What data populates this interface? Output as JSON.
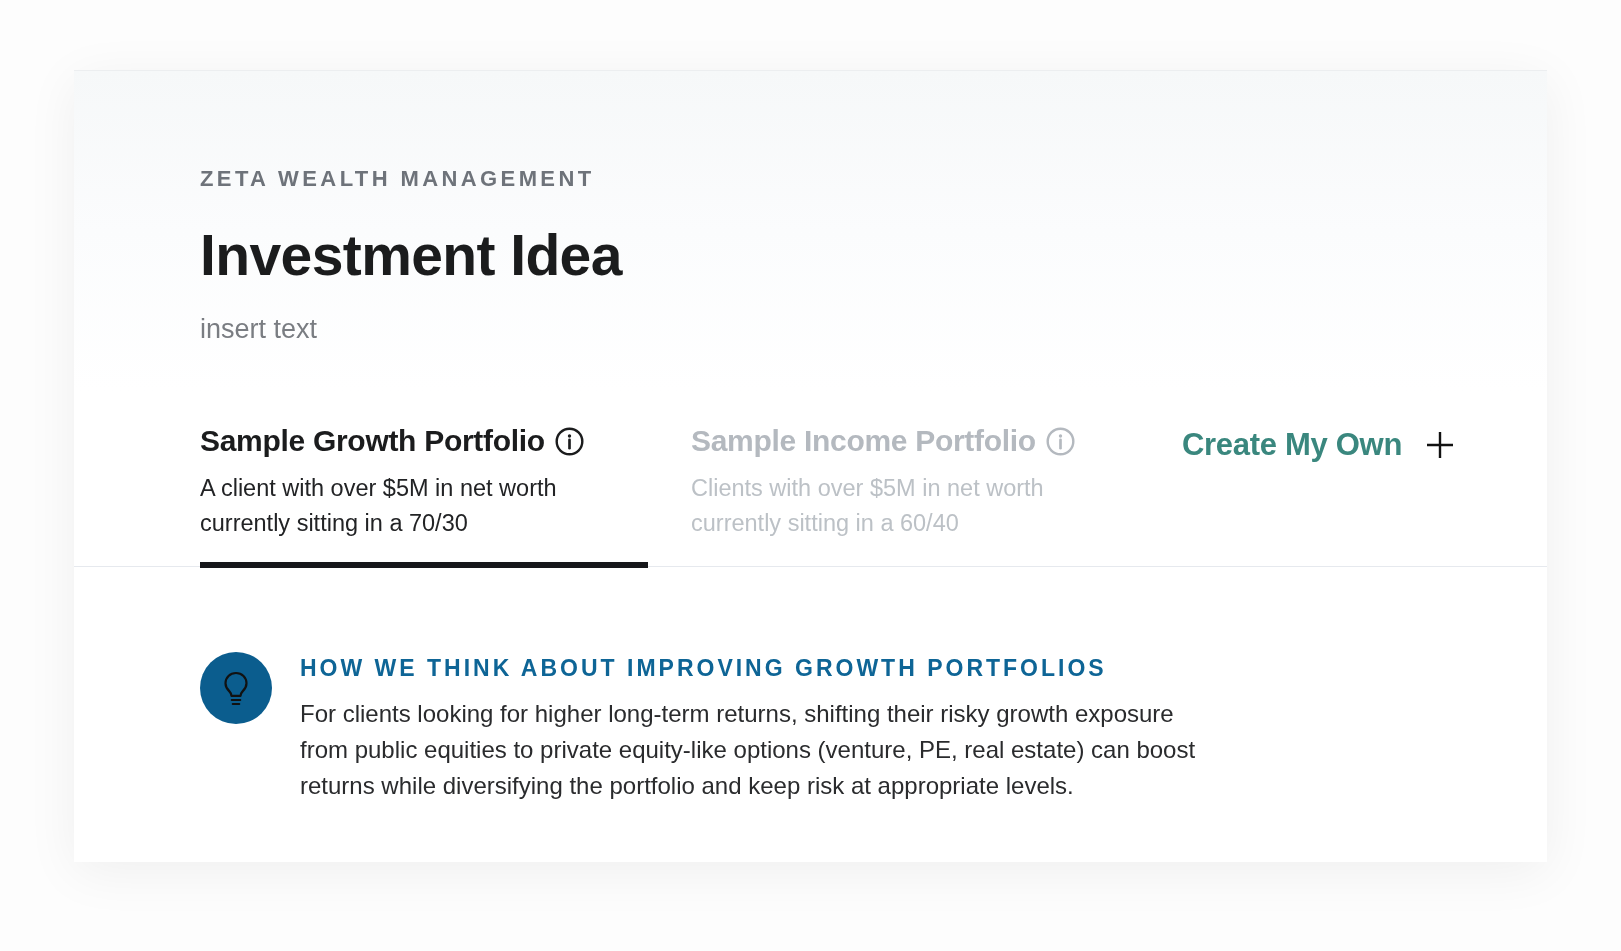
{
  "company": "ZETA WEALTH MANAGEMENT",
  "title": "Investment Idea",
  "subtitle": "insert text",
  "tabs": [
    {
      "label": "Sample Growth Portfolio",
      "description": "A client with over $5M in net worth currently sitting in a 70/30",
      "selected": true
    },
    {
      "label": "Sample Income Portfolio",
      "description": "Clients with over $5M in net worth currently sitting in a 60/40",
      "selected": false
    }
  ],
  "create_button": {
    "label": "Create My Own"
  },
  "insight": {
    "heading": "HOW WE THINK ABOUT IMPROVING GROWTH PORTFOLIOS",
    "body": "For clients looking for higher long-term returns, shifting their risky growth exposure from public equities to private equity-like options (venture, PE, real estate) can boost returns while diversifying the portfolio and keep risk at appropriate levels."
  }
}
